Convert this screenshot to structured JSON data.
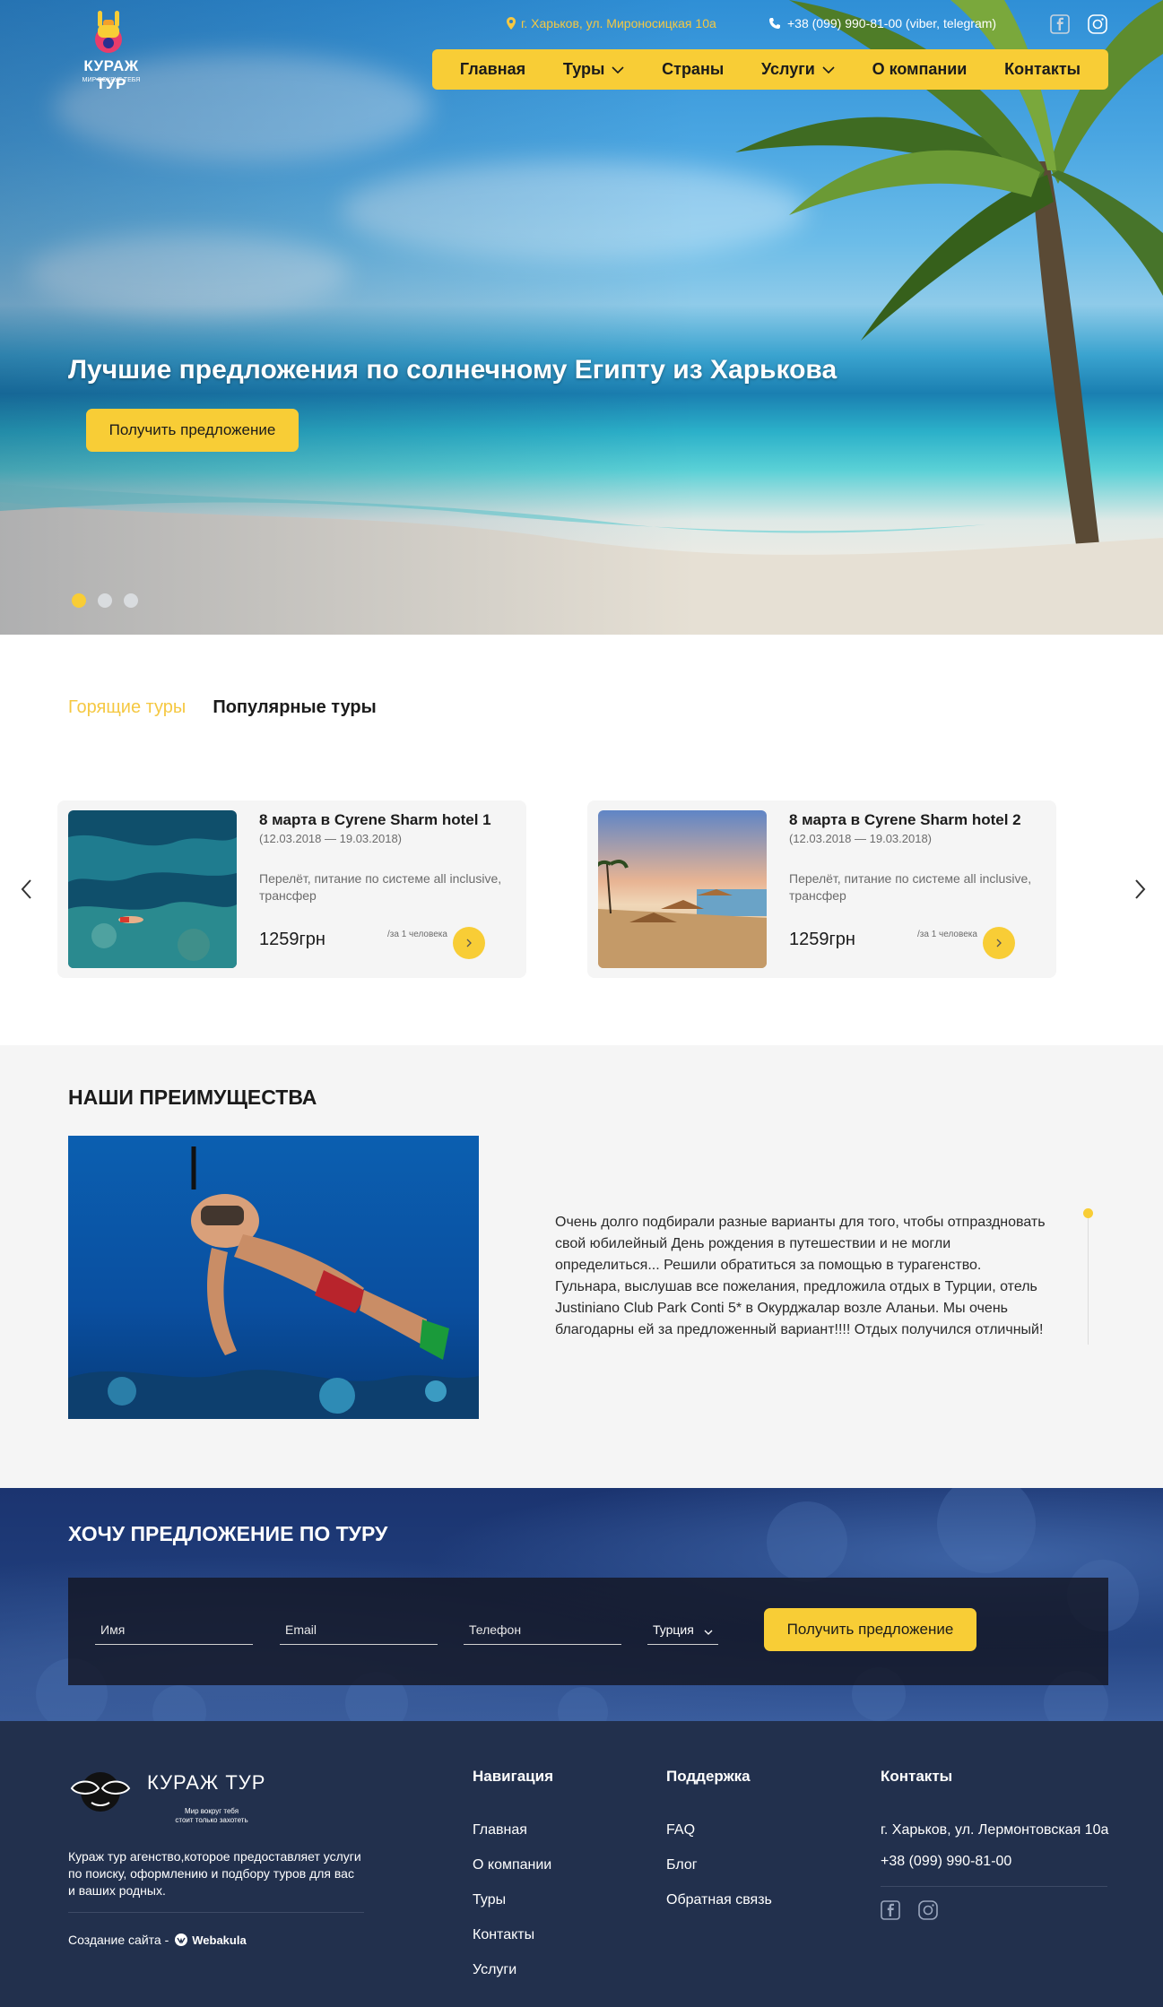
{
  "header": {
    "brand": "КУРАЖ ТУР",
    "brand_slogan": "МИР ВОКРУГ ТЕБЯ",
    "address": "г. Харьков, ул. Мироносицкая 10а",
    "phone": "+38 (099) 990-81-00 (viber, telegram)",
    "nav": [
      "Главная",
      "Туры",
      "Страны",
      "Услуги",
      "О компании",
      "Контакты"
    ]
  },
  "hero": {
    "title": "Лучшие предложения по солнечному Египту из Харькова",
    "cta": "Получить предложение",
    "slides": 3,
    "active_slide": 1
  },
  "tours": {
    "tabs": [
      "Горящие туры",
      "Популярные туры"
    ],
    "active_tab": 0,
    "cards": [
      {
        "title": "8 марта в Cyrene Sharm hotel 1",
        "dates": "(12.03.2018 — 19.03.2018)",
        "desc": "Перелёт, питание по системе all inclusive, трансфер",
        "price": "1259грн",
        "per": "/за 1 человека"
      },
      {
        "title": "8 марта в Cyrene Sharm hotel 2",
        "dates": "(12.03.2018 — 19.03.2018)",
        "desc": "Перелёт, питание по системе all inclusive, трансфер",
        "price": "1259грн",
        "per": "/за 1 человека"
      }
    ]
  },
  "advantages": {
    "title": "НАШИ ПРЕИМУЩЕСТВА",
    "text": "Очень долго подбирали разные варианты для того, чтобы отпраздновать свой юбилейный День рождения в путешествии и не могли определиться... Решили обратиться за помощью в турагенство. Гульнара, выслушав все пожелания, предложила отдых в Турции, отель Justiniano Club Park Conti 5* в Окурджалар возле Аланьи. Мы очень благодарны ей за предложенный вариант!!!! Отдых получился отличный!"
  },
  "offer_form": {
    "title": "ХОЧУ ПРЕДЛОЖЕНИЕ ПО ТУРУ",
    "name_placeholder": "Имя",
    "email_placeholder": "Email",
    "phone_placeholder": "Телефон",
    "country": "Турция",
    "submit": "Получить предложение"
  },
  "footer": {
    "brand": "КУРАЖ ТУР",
    "slogan": "Мир вокруг тебя\nстоит только захотеть",
    "about": "Кураж тур агенство,которое предоставляет услуги по поиску, оформлению и подбору туров для вас и ваших родных.",
    "made_by_label": "Создание сайта -",
    "made_by_name": "Webakula",
    "nav_title": "Навигация",
    "nav_links": [
      "Главная",
      "О компании",
      "Туры",
      "Контакты",
      "Услуги"
    ],
    "support_title": "Поддержка",
    "support_links": [
      "FAQ",
      "Блог",
      "Обратная связь"
    ],
    "contacts_title": "Контакты",
    "contact_address": "г. Харьков, ул. Лермонтовская 10а",
    "contact_phone": "+38 (099) 990-81-00"
  },
  "colors": {
    "accent": "#f8cd36",
    "footer_bg": "#22304d",
    "light_bg": "#f5f5f5"
  },
  "icons": [
    "location-pin-icon",
    "phone-icon",
    "facebook-icon",
    "instagram-icon",
    "chevron-down-icon",
    "chevron-left-icon",
    "chevron-right-icon"
  ]
}
